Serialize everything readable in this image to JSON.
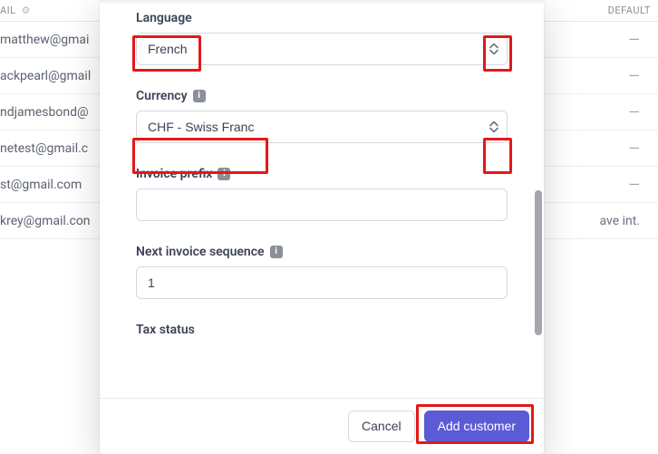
{
  "table": {
    "header_left": "AIL",
    "header_right": "DEFAULT",
    "rows": [
      {
        "email": "matthew@gmai",
        "default": "—"
      },
      {
        "email": "ackpearl@gmail",
        "default": "—"
      },
      {
        "email": "ndjamesbond@",
        "default": "—"
      },
      {
        "email": "netest@gmail.c",
        "default": "—"
      },
      {
        "email": "st@gmail.com",
        "default": "—"
      },
      {
        "email": "krey@gmail.con",
        "default": "ave int."
      }
    ]
  },
  "modal": {
    "language": {
      "label": "Language",
      "value": "French"
    },
    "currency": {
      "label": "Currency",
      "value": "CHF - Swiss Franc"
    },
    "invoice_prefix": {
      "label": "Invoice prefix",
      "value": ""
    },
    "next_invoice_sequence": {
      "label": "Next invoice sequence",
      "value": "1"
    },
    "tax_status": {
      "label": "Tax status"
    },
    "footer": {
      "cancel": "Cancel",
      "submit": "Add customer"
    }
  },
  "icons": {
    "info_glyph": "i",
    "gear_glyph": "⚙"
  },
  "colors": {
    "primary": "#5b5bd6",
    "highlight": "#e41818"
  }
}
